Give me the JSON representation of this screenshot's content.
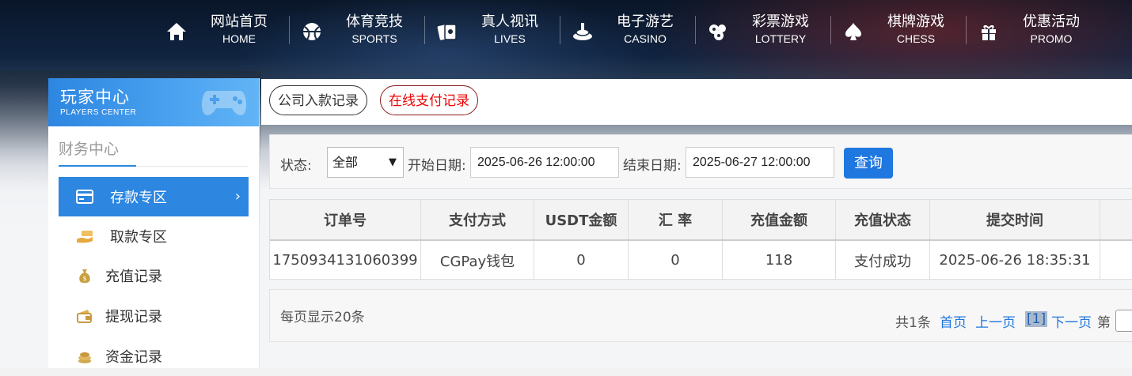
{
  "nav": [
    {
      "zh": "网站首页",
      "en": "HOME",
      "icon": "home-icon"
    },
    {
      "zh": "体育竞技",
      "en": "SPORTS",
      "icon": "ball-icon"
    },
    {
      "zh": "真人视讯",
      "en": "LIVES",
      "icon": "cards-icon"
    },
    {
      "zh": "电子游艺",
      "en": "CASINO",
      "icon": "slot-icon"
    },
    {
      "zh": "彩票游戏",
      "en": "LOTTERY",
      "icon": "lottery-balls-icon"
    },
    {
      "zh": "棋牌游戏",
      "en": "CHESS",
      "icon": "spade-icon"
    },
    {
      "zh": "优惠活动",
      "en": "PROMO",
      "icon": "gift-icon"
    }
  ],
  "sidebar": {
    "title": "玩家中心",
    "subtitle": "PLAYERS CENTER",
    "section": "财务中心",
    "items": [
      {
        "label": "存款专区",
        "icon": "card-icon",
        "active": true
      },
      {
        "label": "取款专区",
        "icon": "hand-money-icon"
      },
      {
        "label": "充值记录",
        "icon": "money-bag-icon"
      },
      {
        "label": "提现记录",
        "icon": "wallet-icon"
      },
      {
        "label": "资金记录",
        "icon": "coins-icon"
      }
    ]
  },
  "tabs": [
    "公司入款记录",
    "在线支付记录"
  ],
  "filter": {
    "status_label": "状态:",
    "status_value": "全部",
    "start_label": "开始日期:",
    "start_value": "2025-06-26 12:00:00",
    "end_label": "结束日期:",
    "end_value": "2025-06-27 12:00:00",
    "query_label": "查询"
  },
  "table": {
    "headers": [
      "订单号",
      "支付方式",
      "USDT金额",
      "汇 率",
      "充值金额",
      "充值状态",
      "提交时间"
    ],
    "rows": [
      [
        "1750934131060399",
        "CGPay钱包",
        "0",
        "0",
        "118",
        "支付成功",
        "2025-06-26 18:35:31"
      ]
    ]
  },
  "pager": {
    "per_page": "每页显示20条",
    "total": "共1条",
    "first": "首页",
    "prev": "上一页",
    "current": "[1]",
    "next": "下一页",
    "goto_prefix": "第"
  },
  "colors": {
    "accent": "#2d86e0",
    "query_button": "#1f77e0",
    "tab_red": "#e00000"
  }
}
